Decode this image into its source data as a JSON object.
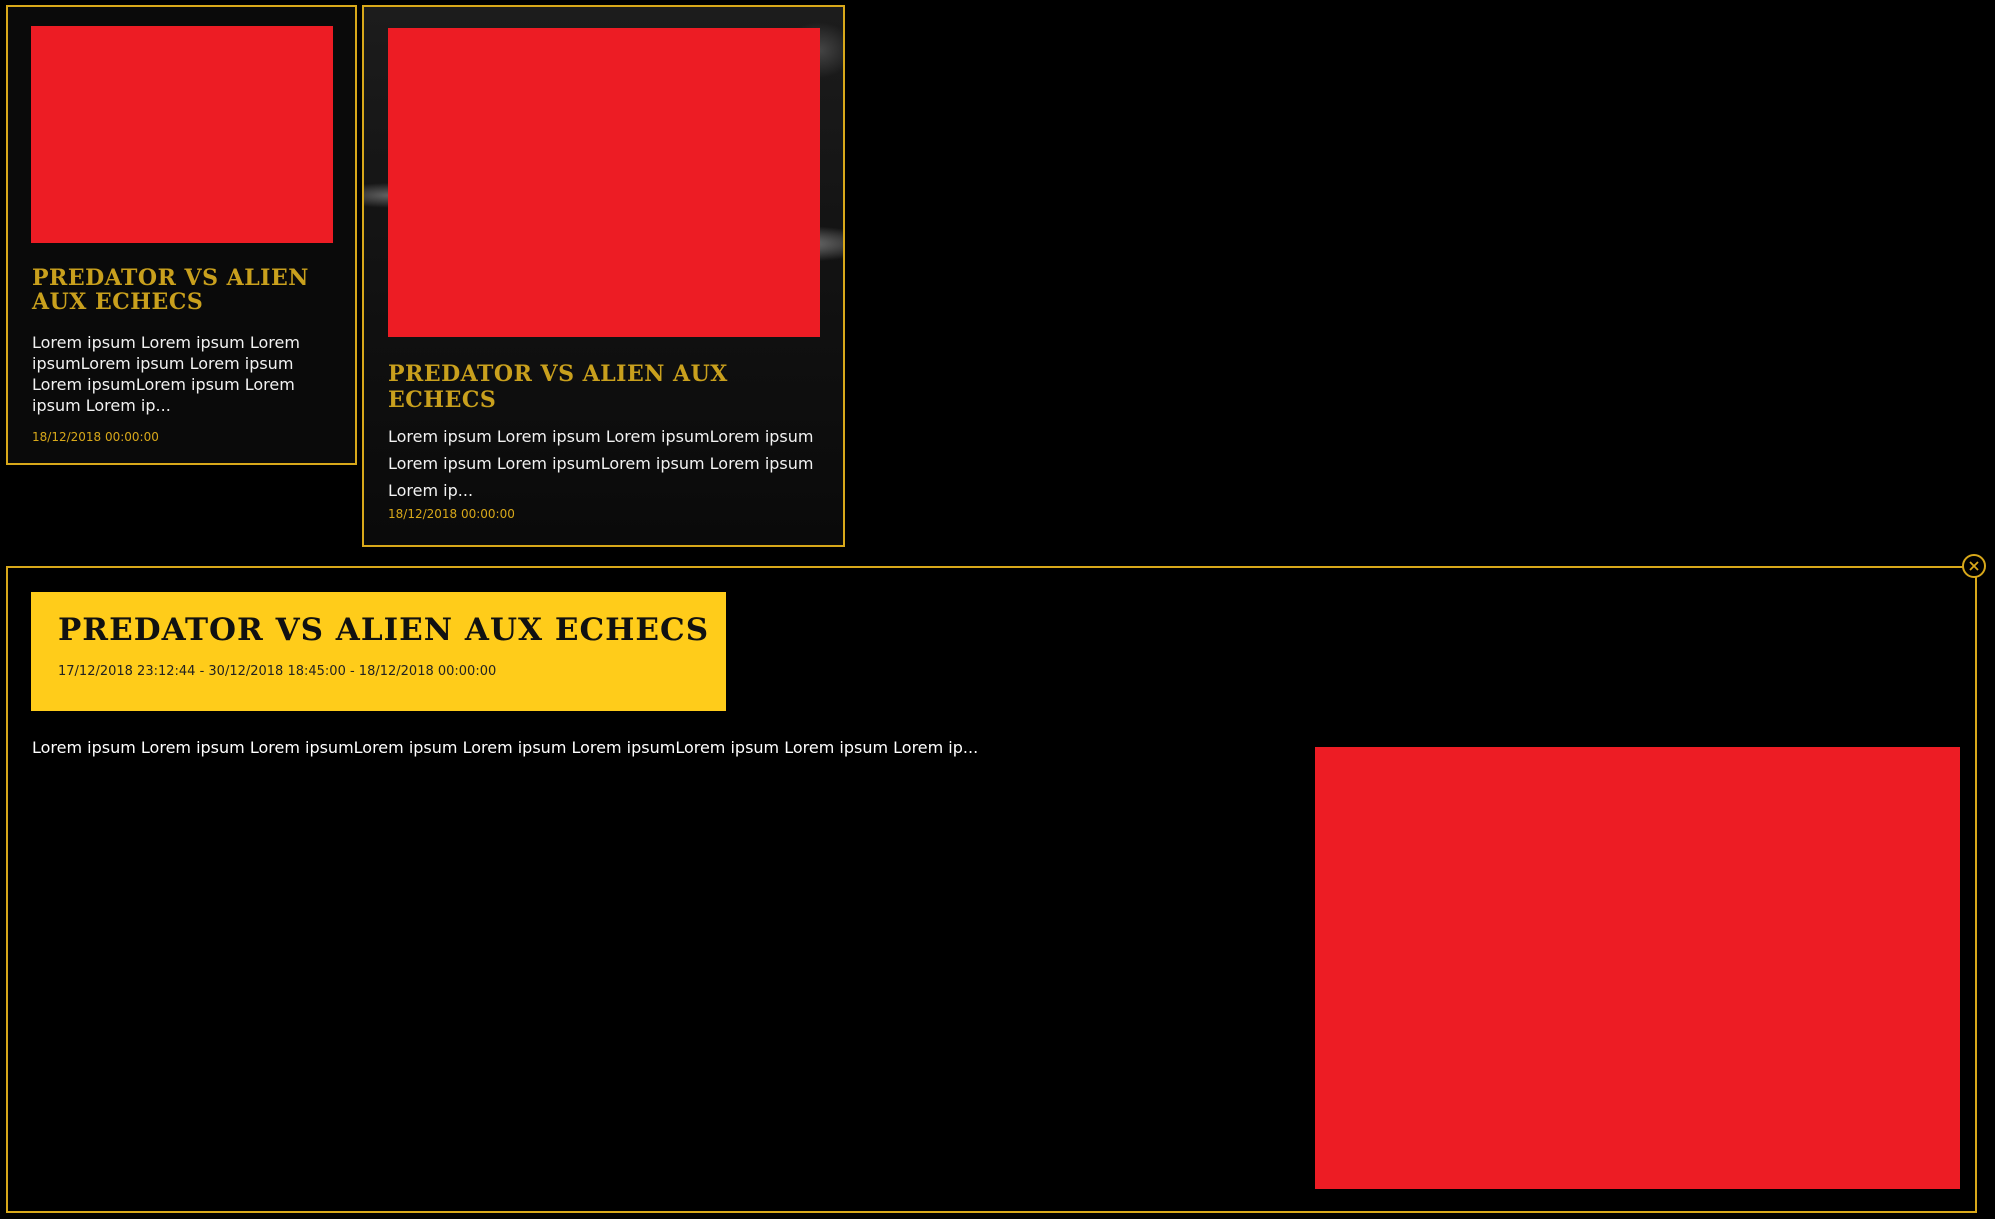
{
  "cards": [
    {
      "title": "PREDATOR VS ALIEN AUX ECHECS",
      "excerpt": "Lorem ipsum Lorem ipsum Lorem ipsumLorem ipsum Lorem ipsum Lorem ipsumLorem ipsum Lorem ipsum Lorem ip...",
      "date": "18/12/2018 00:00:00"
    },
    {
      "title": "PREDATOR VS ALIEN AUX ECHECS",
      "excerpt": "Lorem ipsum Lorem ipsum Lorem ipsumLorem ipsum Lorem ipsum Lorem ipsumLorem ipsum Lorem ipsum Lorem ip...",
      "date": "18/12/2018 00:00:00"
    }
  ],
  "modal": {
    "title": "PREDATOR VS ALIEN AUX ECHECS",
    "dates": "17/12/2018 23:12:44 - 30/12/2018 18:45:00 - 18/12/2018 00:00:00",
    "text": "Lorem ipsum Lorem ipsum Lorem ipsumLorem ipsum Lorem ipsum Lorem ipsumLorem ipsum Lorem ipsum Lorem ip...",
    "close_icon": "close-icon"
  },
  "colors": {
    "accent": "#d8a81a",
    "header_bg": "#ffcc1a",
    "image_placeholder": "#ed1c24",
    "background": "#000000"
  }
}
